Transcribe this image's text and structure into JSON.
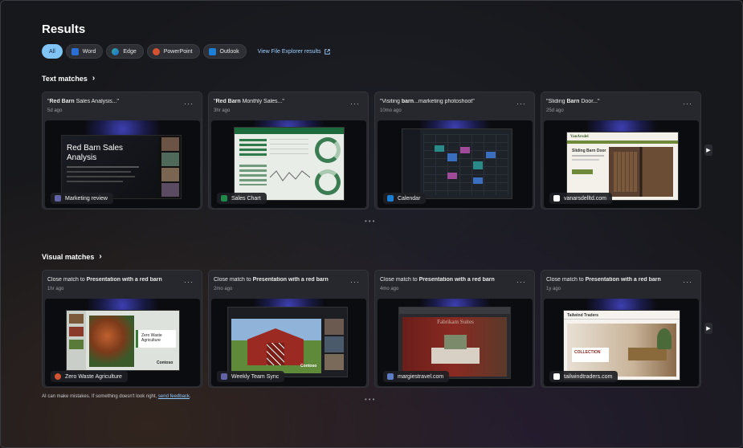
{
  "page": {
    "title": "Results"
  },
  "filters": [
    {
      "label": "All",
      "icon": "all",
      "color": "#7fc4f5",
      "active": true
    },
    {
      "label": "Word",
      "icon": "word-icon",
      "color": "#2b6fd6"
    },
    {
      "label": "Edge",
      "icon": "edge-icon",
      "color": "#2fa7a0"
    },
    {
      "label": "PowerPoint",
      "icon": "powerpoint-icon",
      "color": "#d35230"
    },
    {
      "label": "Outlook",
      "icon": "outlook-icon",
      "color": "#1b7fd6"
    }
  ],
  "file_explorer_link": "View File Explorer results",
  "text_matches": {
    "title": "Text matches",
    "cards": [
      {
        "title_bold": "Red Barn",
        "title_rest": " Sales Analysis...",
        "title_pre": "\"",
        "title_post": "\"",
        "time": "5d ago",
        "source": "Marketing review",
        "source_icon": "teams-icon",
        "icon_color": "#6264a7",
        "thumb_heading": "Red Barn Sales Analysis"
      },
      {
        "title_bold": "Red Barn",
        "title_rest": " Monthly Sales...",
        "title_pre": "\"",
        "title_post": "\"",
        "time": "3hr ago",
        "source": "Sales Chart",
        "source_icon": "excel-icon",
        "icon_color": "#1d8a4a"
      },
      {
        "title_pre": "\"Visiting ",
        "title_bold": "barn",
        "title_rest": "...marketing photoshoot",
        "title_post": "\"",
        "time": "10mo ago",
        "source": "Calendar",
        "source_icon": "outlook-icon",
        "icon_color": "#1b7fd6"
      },
      {
        "title_pre": "\"Sliding ",
        "title_bold": "Barn",
        "title_rest": " Door...",
        "title_post": "\"",
        "time": "25d ago",
        "source": "vanarsdelltd.com",
        "source_icon": "site-icon",
        "icon_color": "#ffffff",
        "thumb_brand": "VanArsdel",
        "thumb_heading": "Sliding Barn Door"
      }
    ]
  },
  "visual_matches": {
    "title": "Visual matches",
    "cards": [
      {
        "prefix": "Close match to ",
        "bold": "Presentation with a red barn",
        "time": "1hr ago",
        "source": "Zero Waste Agriculture",
        "source_icon": "powerpoint-icon",
        "icon_color": "#d35230",
        "thumb_heading": "Zero Waste Agriculture",
        "thumb_brand": "Contoso"
      },
      {
        "prefix": "Close match to ",
        "bold": "Presentation with a red barn",
        "time": "2mo ago",
        "source": "Weekly Team Sync",
        "source_icon": "teams-icon",
        "icon_color": "#6264a7",
        "thumb_brand": "Contoso"
      },
      {
        "prefix": "Close match to ",
        "bold": "Presentation with a red barn",
        "time": "4mo ago",
        "source": "margiestravel.com",
        "source_icon": "site-icon",
        "icon_color": "#5c7cc4",
        "thumb_heading": "Fabrikam Suites"
      },
      {
        "prefix": "Close match to ",
        "bold": "Presentation with a red barn",
        "time": "1y ago",
        "source": "tailwindtraders.com",
        "source_icon": "site-icon",
        "icon_color": "#ffffff",
        "thumb_brand": "Tailwind Traders",
        "thumb_heading": "COLLECTION"
      }
    ]
  },
  "footer": {
    "text": "AI can make mistakes. If something doesn't look right, ",
    "link": "send feedback",
    "end": "."
  }
}
